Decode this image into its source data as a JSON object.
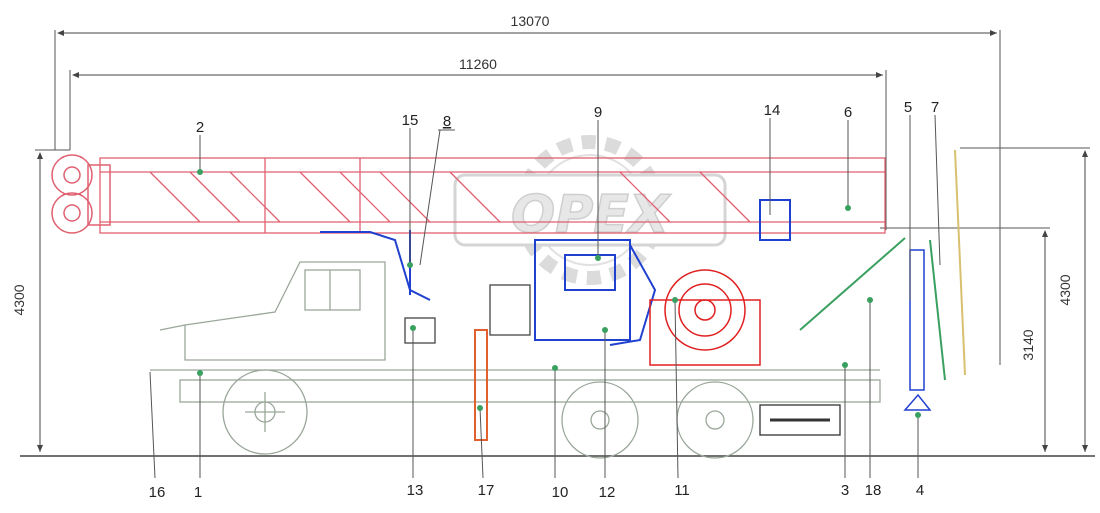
{
  "dimensions": {
    "overall_length": "13070",
    "wheelbase_span": "11260",
    "left_height": "4300",
    "right_height": "4300",
    "mid_height": "3140"
  },
  "callouts": {
    "c1": "1",
    "c2": "2",
    "c3": "3",
    "c4": "4",
    "c5": "5",
    "c6": "6",
    "c7": "7",
    "c8": "8",
    "c9": "9",
    "c10": "10",
    "c11": "11",
    "c12": "12",
    "c13": "13",
    "c14": "14",
    "c15": "15",
    "c16": "16",
    "c17": "17",
    "c18": "18"
  },
  "watermark": "OPEX",
  "colors": {
    "mast": "#e06070",
    "hydraulics": "#2040d0",
    "winch": "#e02020",
    "lines": "#444444",
    "truck": "#a0b0a0",
    "accent": "#3aa060",
    "yellow": "#d8c070"
  }
}
